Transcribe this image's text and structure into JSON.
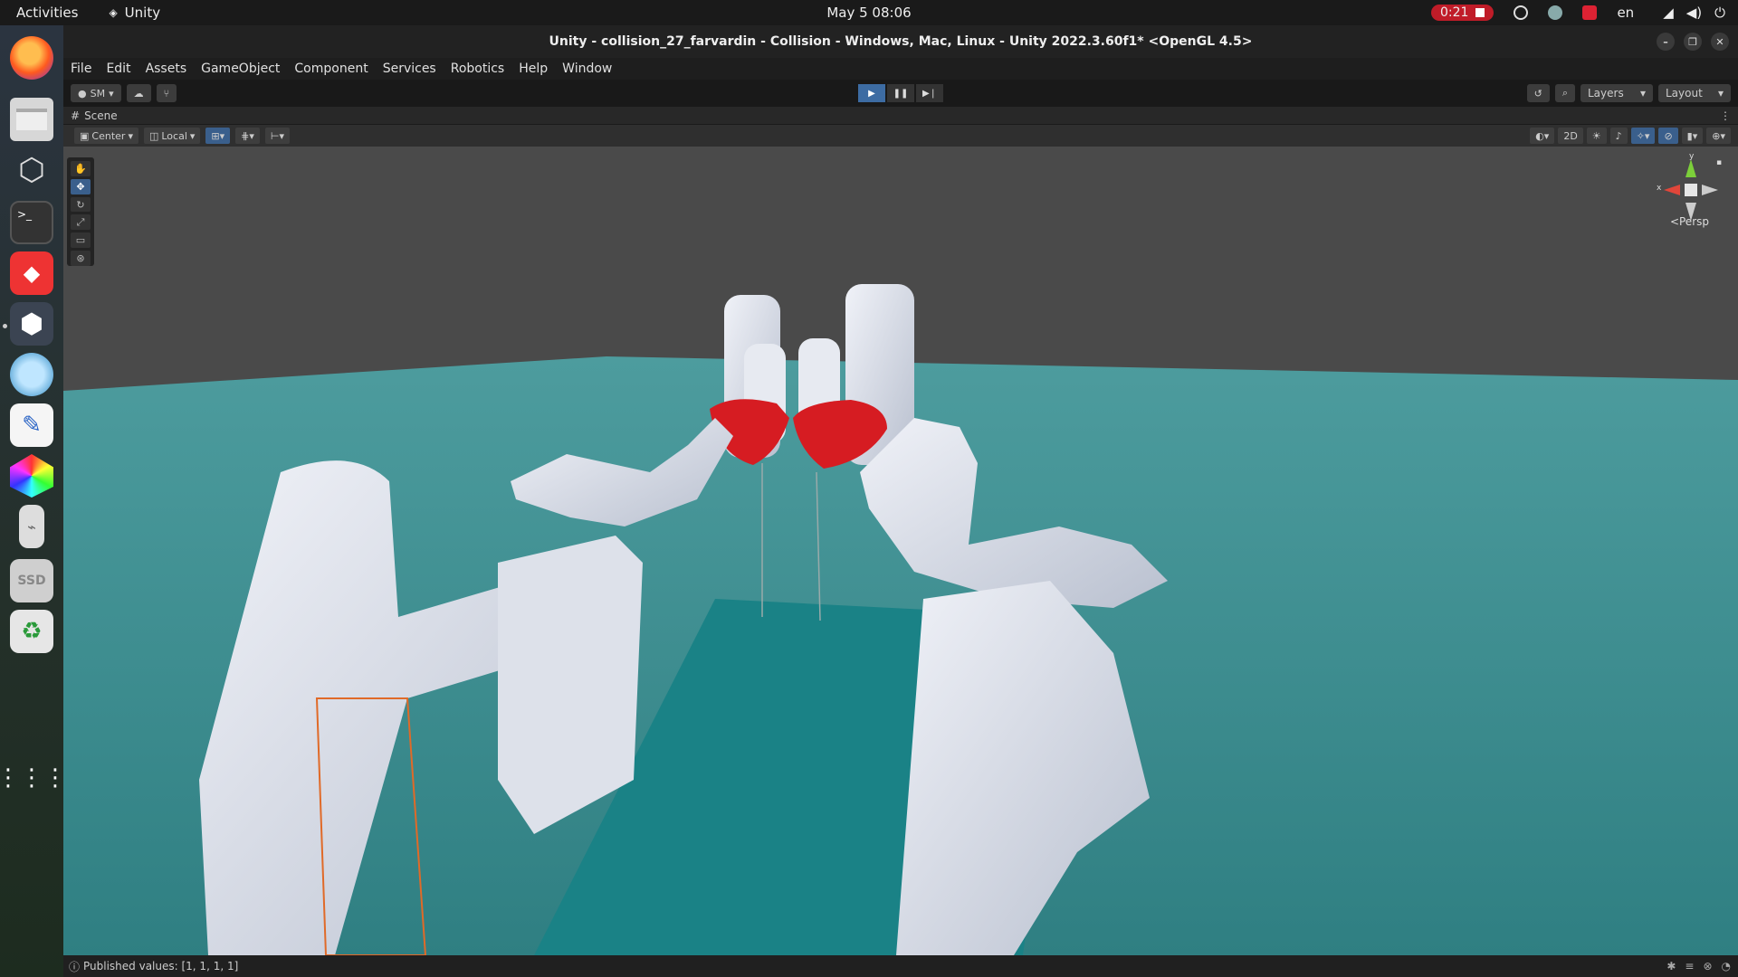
{
  "topbar": {
    "activities": "Activities",
    "app_name": "Unity",
    "clock": "May 5  08:06",
    "recording_time": "0:21",
    "language": "en"
  },
  "dock": {
    "items": [
      "firefox-icon",
      "files-icon",
      "unity-hub-icon",
      "terminal-icon",
      "anydesk-icon",
      "unity-editor-icon",
      "avatar-app-icon",
      "text-editor-icon",
      "blender-icon",
      "usb-drive-icon",
      "ssd-drive-icon",
      "trash-icon",
      "show-apps-icon"
    ],
    "ssd_label": "SSD"
  },
  "window": {
    "title": "Unity - collision_27_farvardin - Collision - Windows, Mac, Linux - Unity 2022.3.60f1* <OpenGL 4.5>"
  },
  "menubar": [
    "File",
    "Edit",
    "Assets",
    "GameObject",
    "Component",
    "Services",
    "Robotics",
    "Help",
    "Window"
  ],
  "toolbar": {
    "account": "SM",
    "layers": "Layers",
    "layout": "Layout"
  },
  "scene": {
    "tab_label": "Scene",
    "pivot": "Center",
    "space": "Local",
    "mode_2d": "2D",
    "projection": "Persp",
    "axis_y": "y",
    "axis_x": "x"
  },
  "status": {
    "message": "Published values: [1, 1, 1, 1]"
  },
  "colors": {
    "floor": "#3a8f91",
    "sky": "#4a4a4a",
    "robot": "#dfe4ee",
    "highlight": "#d7191f",
    "table": "#197f83"
  }
}
